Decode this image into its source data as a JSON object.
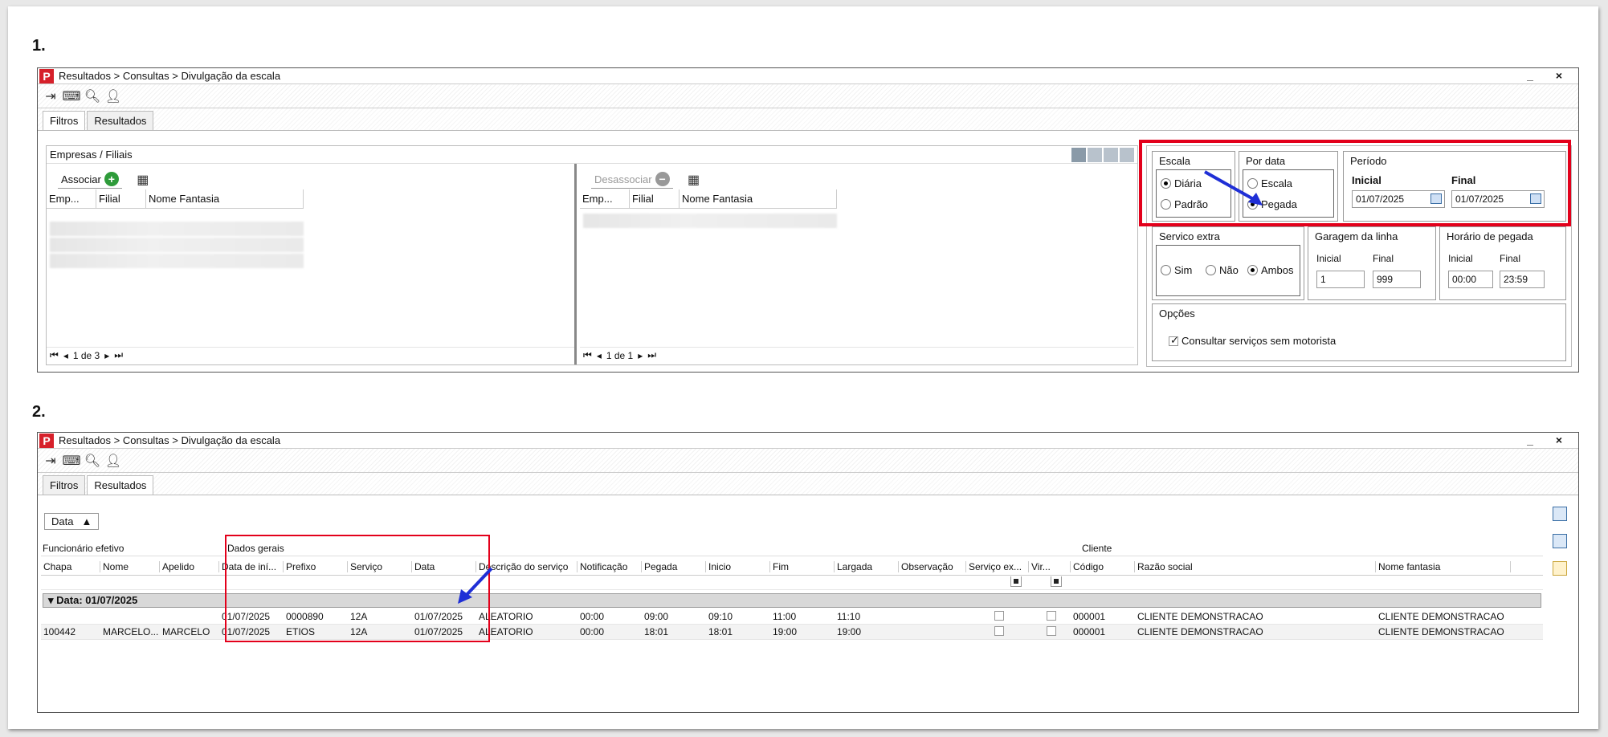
{
  "step1": {
    "label": "1."
  },
  "step2": {
    "label": "2."
  },
  "window": {
    "title": "Resultados > Consultas > Divulgação da escala",
    "controls": "_ ×",
    "tabs": [
      "Filtros",
      "Resultados"
    ]
  },
  "filters": {
    "empresas_title": "Empresas / Filiais",
    "associar_label": "Associar",
    "desassociar_label": "Desassociar",
    "grid_columns": [
      "Emp...",
      "Filial",
      "Nome Fantasia"
    ],
    "left_pager": "1 de 3",
    "right_pager": "1 de 1",
    "escala": {
      "title": "Escala",
      "options": [
        "Diária",
        "Padrão"
      ],
      "selected": "Diária"
    },
    "por_data": {
      "title": "Por data",
      "options": [
        "Escala",
        "Pegada"
      ],
      "selected": "Pegada"
    },
    "periodo": {
      "title": "Período",
      "inicial_label": "Inicial",
      "final_label": "Final",
      "inicial_value": "01/07/2025",
      "final_value": "01/07/2025"
    },
    "servico_extra": {
      "title": "Servico extra",
      "options": [
        "Sim",
        "Não",
        "Ambos"
      ],
      "selected": "Ambos"
    },
    "garagem": {
      "title": "Garagem da linha",
      "inicial_label": "Inicial",
      "final_label": "Final",
      "inicial_value": "1",
      "final_value": "999"
    },
    "horario": {
      "title": "Horário de pegada",
      "inicial_label": "Inicial",
      "final_label": "Final",
      "inicial_value": "00:00",
      "final_value": "23:59"
    },
    "opcoes": {
      "title": "Opções",
      "checkbox_label": "Consultar serviços sem motorista",
      "checked": true
    }
  },
  "results": {
    "group_by_button": "Data",
    "band_funcionario": "Funcionário efetivo",
    "band_dados": "Dados gerais",
    "band_cliente": "Cliente",
    "columns": [
      "Chapa",
      "Nome",
      "Apelido",
      "Data de iní...",
      "Prefixo",
      "Serviço",
      "Data",
      "Descrição do serviço",
      "Notificação",
      "Pegada",
      "Inicio",
      "Fim",
      "Largada",
      "Observação",
      "Serviço ex...",
      "Vir...",
      "Código",
      "Razão social",
      "Nome fantasia"
    ],
    "group_label": "Data: 01/07/2025",
    "rows": [
      [
        "",
        "",
        "",
        "01/07/2025",
        "0000890",
        "12A",
        "01/07/2025",
        "ALEATORIO",
        "00:00",
        "09:00",
        "09:10",
        "11:00",
        "11:10",
        "",
        "",
        "",
        "000001",
        "CLIENTE DEMONSTRACAO",
        "CLIENTE DEMONSTRACAO"
      ],
      [
        "100442",
        "MARCELO...",
        "MARCELO",
        "01/07/2025",
        "ETIOS",
        "12A",
        "01/07/2025",
        "ALEATORIO",
        "00:00",
        "18:01",
        "18:01",
        "19:00",
        "19:00",
        "",
        "",
        "",
        "000001",
        "CLIENTE DEMONSTRACAO",
        "CLIENTE DEMONSTRACAO"
      ]
    ]
  },
  "colors": {
    "highlight": "#e3001b",
    "arrow": "#1f2fd6",
    "add_green": "#2e9b3a"
  }
}
